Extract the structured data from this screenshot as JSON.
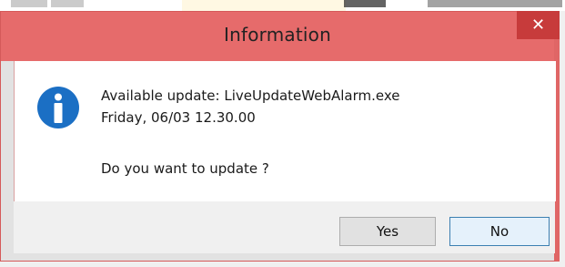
{
  "dialog": {
    "title": "Information",
    "close_label": "✕",
    "message_line1": "Available update: LiveUpdateWebAlarm.exe",
    "message_line2": "Friday, 06/03 12.30.00",
    "message_line3": "Do you want to update ?",
    "icon": "info-icon",
    "buttons": {
      "yes": "Yes",
      "no": "No"
    }
  },
  "colors": {
    "titlebar": "#e66b6b",
    "close_button": "#c73b3b",
    "info_icon": "#1b6fc4",
    "default_button_border": "#3c7fb1"
  }
}
